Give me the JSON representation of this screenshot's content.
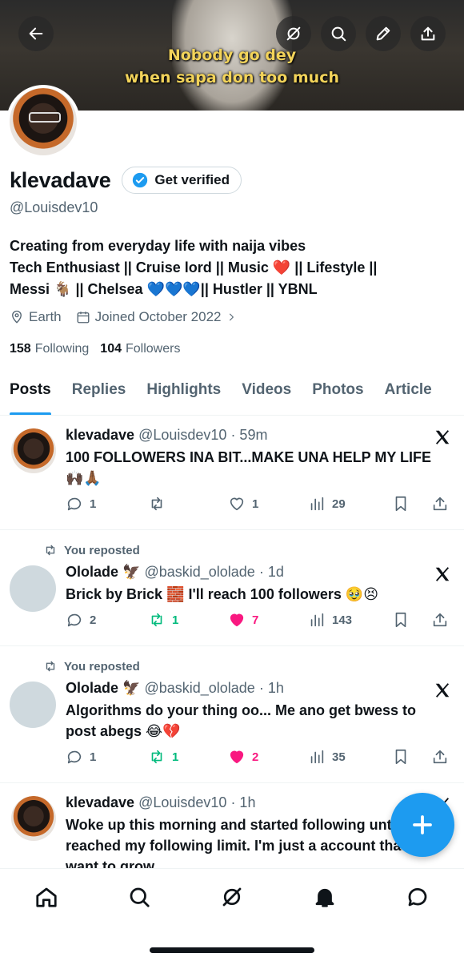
{
  "banner": {
    "caption_line1": "Nobody go dey",
    "caption_line2": "when sapa don too much"
  },
  "profile": {
    "display_name": "klevadave",
    "verify_label": "Get verified",
    "handle": "@Louisdev10",
    "bio_line1": "Creating from everyday life with naija vibes",
    "bio_line2": "Tech Enthusiast || Cruise lord || Music ❤️ || Lifestyle ||",
    "bio_line3": "Messi 🐐 || Chelsea 💙💙💙|| Hustler || YBNL",
    "location": "Earth",
    "joined": "Joined October 2022",
    "following_count": "158",
    "following_label": "Following",
    "followers_count": "104",
    "followers_label": "Followers"
  },
  "tabs": [
    {
      "label": "Posts",
      "active": true
    },
    {
      "label": "Replies"
    },
    {
      "label": "Highlights"
    },
    {
      "label": "Videos"
    },
    {
      "label": "Photos"
    },
    {
      "label": "Article"
    }
  ],
  "posts": [
    {
      "name": "klevadave",
      "handle": "@Louisdev10 · 59m",
      "text": "100 FOLLOWERS INA BIT...MAKE UNA HELP MY LIFE 🙌🏿🙏🏾",
      "replies": "1",
      "reposts": "",
      "likes": "1",
      "views": "29"
    },
    {
      "repost_label": "You reposted",
      "name": "Ololade 🦅",
      "handle": "@baskid_ololade · 1d",
      "text": "Brick by Brick 🧱 I'll reach 100 followers 🥹😣",
      "replies": "2",
      "reposts": "1",
      "likes": "7",
      "views": "143"
    },
    {
      "repost_label": "You reposted",
      "name": "Ololade 🦅",
      "handle": "@baskid_ololade · 1h",
      "text": "Algorithms do your thing oo... Me ano get bwess to post abegs 😂💔",
      "replies": "1",
      "reposts": "1",
      "likes": "2",
      "views": "35"
    },
    {
      "name": "klevadave",
      "handle": "@Louisdev10 · 1h",
      "text": "Woke up this morning and started following until I reached my following limit. I'm just a account that want to grow"
    }
  ],
  "colors": {
    "accent": "#1d9bf0",
    "repost_green": "#00ba7c",
    "like_pink": "#f91880",
    "muted": "#536471"
  }
}
